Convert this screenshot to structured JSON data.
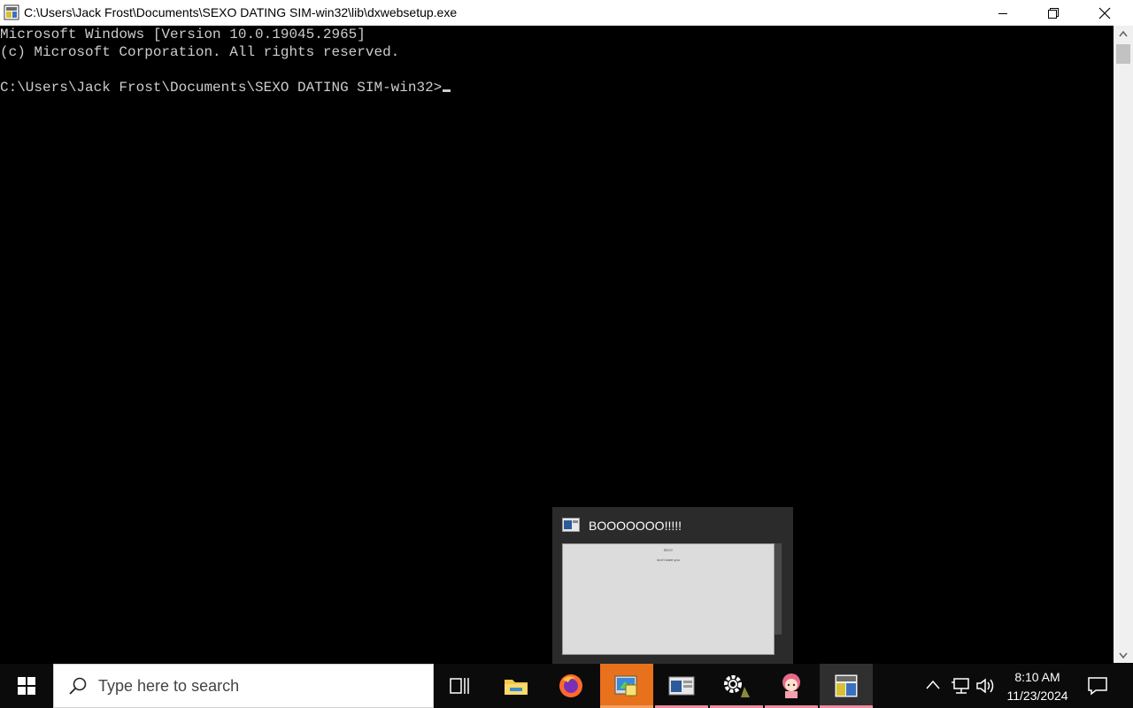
{
  "window": {
    "title": "C:\\Users\\Jack Frost\\Documents\\SEXO DATING SIM-win32\\lib\\dxwebsetup.exe"
  },
  "console": {
    "lines": [
      "Microsoft Windows [Version 10.0.19045.2965]",
      "(c) Microsoft Corporation. All rights reserved.",
      "",
      "C:\\Users\\Jack Frost\\Documents\\SEXO DATING SIM-win32>"
    ]
  },
  "preview": {
    "title": "BOOOOOOO!!!!!",
    "thumb_title": "SEXY",
    "thumb_text": "don't want you"
  },
  "taskbar": {
    "search_placeholder": "Type here to search",
    "items": [
      {
        "icon": "task-view-icon"
      },
      {
        "icon": "file-explorer-icon"
      },
      {
        "icon": "firefox-icon"
      },
      {
        "icon": "sexo-dating-sim-icon",
        "active": true
      },
      {
        "icon": "preview-window-icon"
      },
      {
        "icon": "settings-icon"
      },
      {
        "icon": "anime-character-icon"
      },
      {
        "icon": "command-prompt-icon",
        "active": true
      }
    ],
    "clock": {
      "time": "8:10 AM",
      "date": "11/23/2024"
    }
  },
  "colors": {
    "accent_orange": "#e8711c",
    "indicator_pink": "#f08ca0",
    "console_text": "#cccccc"
  }
}
